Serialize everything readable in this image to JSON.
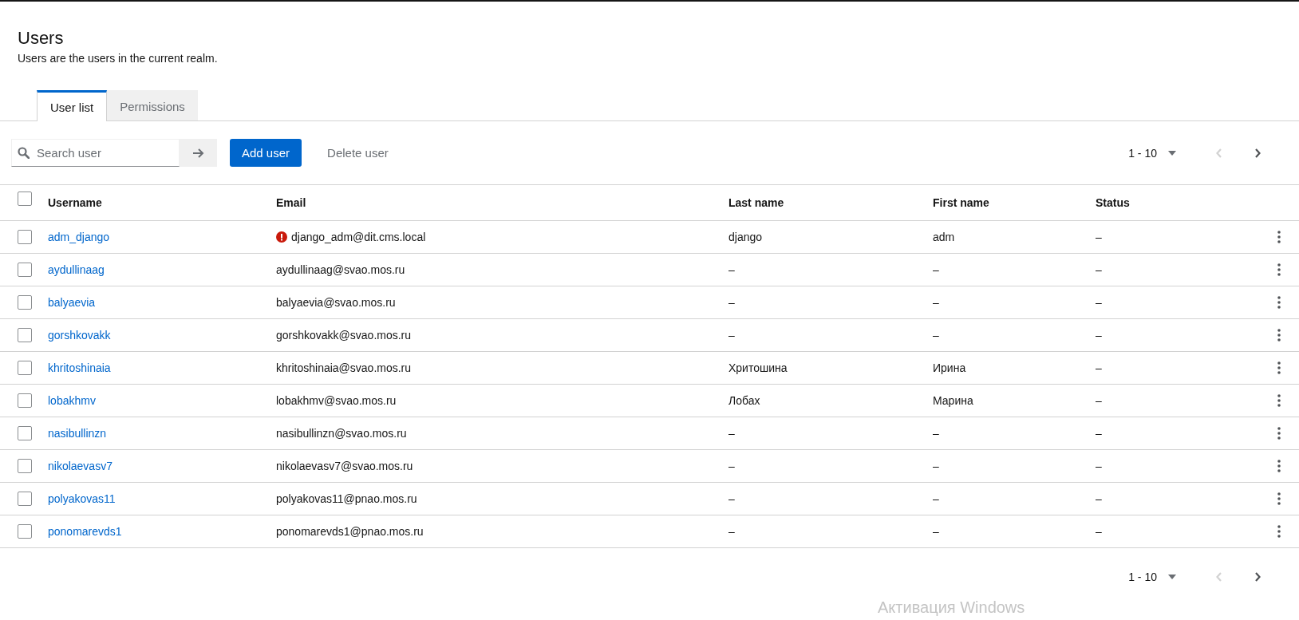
{
  "page": {
    "title": "Users",
    "description": "Users are the users in the current realm."
  },
  "tabs": [
    {
      "label": "User list",
      "selected": true
    },
    {
      "label": "Permissions",
      "selected": false
    }
  ],
  "toolbar": {
    "search": {
      "placeholder": "Search user"
    },
    "add_button": "Add user",
    "delete_button": {
      "label": "Delete user",
      "disabled": true
    }
  },
  "pagination_top": {
    "range": "1 - 10",
    "prev_disabled": true,
    "next_disabled": false
  },
  "table": {
    "select_all": {
      "checked": false
    },
    "columns": [
      "Username",
      "Email",
      "Last name",
      "First name",
      "Status"
    ],
    "rows": [
      {
        "checked": false,
        "username": "adm_django",
        "email": "django_adm@dit.cms.local",
        "email_invalid": true,
        "last_name": "django",
        "first_name": "adm",
        "status": "–"
      },
      {
        "checked": false,
        "username": "aydullinaag",
        "email": "aydullinaag@svao.mos.ru",
        "email_invalid": false,
        "last_name": "–",
        "first_name": "–",
        "status": "–"
      },
      {
        "checked": false,
        "username": "balyaevia",
        "email": "balyaevia@svao.mos.ru",
        "email_invalid": false,
        "last_name": "–",
        "first_name": "–",
        "status": "–"
      },
      {
        "checked": false,
        "username": "gorshkovakk",
        "email": "gorshkovakk@svao.mos.ru",
        "email_invalid": false,
        "last_name": "–",
        "first_name": "–",
        "status": "–"
      },
      {
        "checked": false,
        "username": "khritoshinaia",
        "email": "khritoshinaia@svao.mos.ru",
        "email_invalid": false,
        "last_name": "Хритошина",
        "first_name": "Ирина",
        "status": "–"
      },
      {
        "checked": false,
        "username": "lobakhmv",
        "email": "lobakhmv@svao.mos.ru",
        "email_invalid": false,
        "last_name": "Лобах",
        "first_name": "Марина",
        "status": "–"
      },
      {
        "checked": false,
        "username": "nasibullinzn",
        "email": "nasibullinzn@svao.mos.ru",
        "email_invalid": false,
        "last_name": "–",
        "first_name": "–",
        "status": "–"
      },
      {
        "checked": false,
        "username": "nikolaevasv7",
        "email": "nikolaevasv7@svao.mos.ru",
        "email_invalid": false,
        "last_name": "–",
        "first_name": "–",
        "status": "–"
      },
      {
        "checked": false,
        "username": "polyakovas11",
        "email": "polyakovas11@pnao.mos.ru",
        "email_invalid": false,
        "last_name": "–",
        "first_name": "–",
        "status": "–"
      },
      {
        "checked": false,
        "username": "ponomarevds1",
        "email": "ponomarevds1@pnao.mos.ru",
        "email_invalid": false,
        "last_name": "–",
        "first_name": "–",
        "status": "–"
      }
    ]
  },
  "pagination_bottom": {
    "range": "1 - 10",
    "prev_disabled": true,
    "next_disabled": false
  },
  "os_notice": "Активация Windows"
}
